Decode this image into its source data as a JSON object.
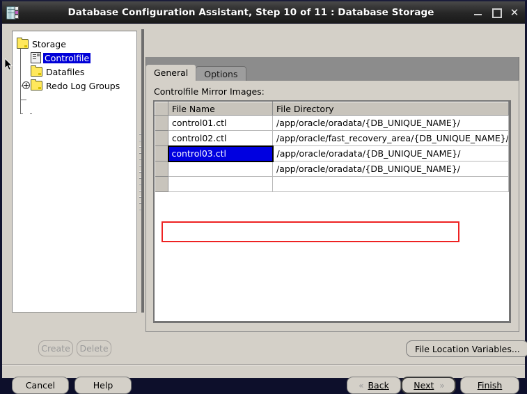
{
  "window": {
    "title": "Database Configuration Assistant, Step 10 of 11 : Database Storage",
    "app_icon": "database-icon",
    "controls": {
      "minimize": "minimize-icon",
      "maximize": "maximize-icon",
      "close": "✕"
    }
  },
  "tree": {
    "nodes": [
      {
        "label": "Storage",
        "icon": "folder-icon",
        "level": 0,
        "handle": "collapse",
        "selected": false
      },
      {
        "label": "Controlfile",
        "icon": "controlfile-icon",
        "level": 1,
        "handle": "none",
        "selected": true
      },
      {
        "label": "Datafiles",
        "icon": "folder-icon",
        "level": 1,
        "handle": "none",
        "selected": false
      },
      {
        "label": "Redo Log Groups",
        "icon": "folder-icon",
        "level": 1,
        "handle": "expand",
        "selected": false
      }
    ]
  },
  "tabs": [
    {
      "label": "General",
      "active": true
    },
    {
      "label": "Options",
      "active": false
    }
  ],
  "panel": {
    "section_label": "Controlfile Mirror Images:",
    "table": {
      "columns": [
        "",
        "File Name",
        "File Directory"
      ],
      "rows": [
        {
          "file_name": "control01.ctl",
          "file_directory": "/app/oracle/oradata/{DB_UNIQUE_NAME}/",
          "selected": false
        },
        {
          "file_name": "control02.ctl",
          "file_directory": "/app/oracle/fast_recovery_area/{DB_UNIQUE_NAME}/",
          "selected": false
        },
        {
          "file_name": "control03.ctl",
          "file_directory": "/app/oracle/oradata/{DB_UNIQUE_NAME}/",
          "selected": true
        },
        {
          "file_name": "",
          "file_directory": "/app/oracle/oradata/{DB_UNIQUE_NAME}/",
          "selected": false
        }
      ]
    }
  },
  "buttons": {
    "create": "Create",
    "delete": "Delete",
    "file_location_variables": "File Location Variables...",
    "cancel": "Cancel",
    "help": "Help",
    "back": "Back",
    "next": "Next",
    "finish": "Finish",
    "back_chevron": "«",
    "next_chevron": "»"
  },
  "colors": {
    "selection_blue": "#0000e0",
    "highlight_red": "#ee2222",
    "folder_yellow": "#ffe85c",
    "window_face": "#d4d0c8"
  }
}
